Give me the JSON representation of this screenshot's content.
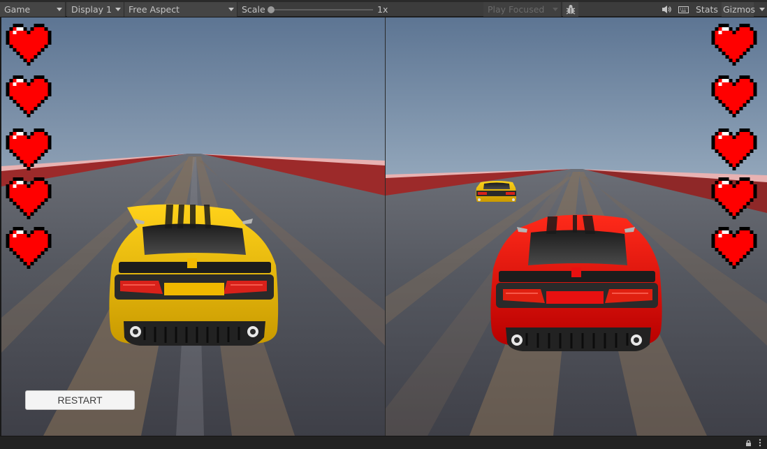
{
  "toolbar": {
    "view_label": "Game",
    "display_label": "Display 1",
    "aspect_label": "Free Aspect",
    "scale_label": "Scale",
    "scale_value": "1x",
    "scale_level": 0,
    "play_focused_label": "Play Focused",
    "stats_label": "Stats",
    "gizmos_label": "Gizmos"
  },
  "icons": {
    "debug": "bug-icon",
    "mute": "speaker-icon",
    "stats": "keyboard-icon",
    "lock": "lock-icon",
    "menu": "more-icon"
  },
  "game": {
    "player1": {
      "lives": 5,
      "car_color": "#f2c200"
    },
    "player2": {
      "lives": 5,
      "car_color": "#e81010"
    },
    "restart_label": "RESTART"
  },
  "colors": {
    "heart": "#ff0000",
    "heart_outline": "#000000",
    "barrier": "#b52b2b",
    "road": "#4f525b"
  }
}
